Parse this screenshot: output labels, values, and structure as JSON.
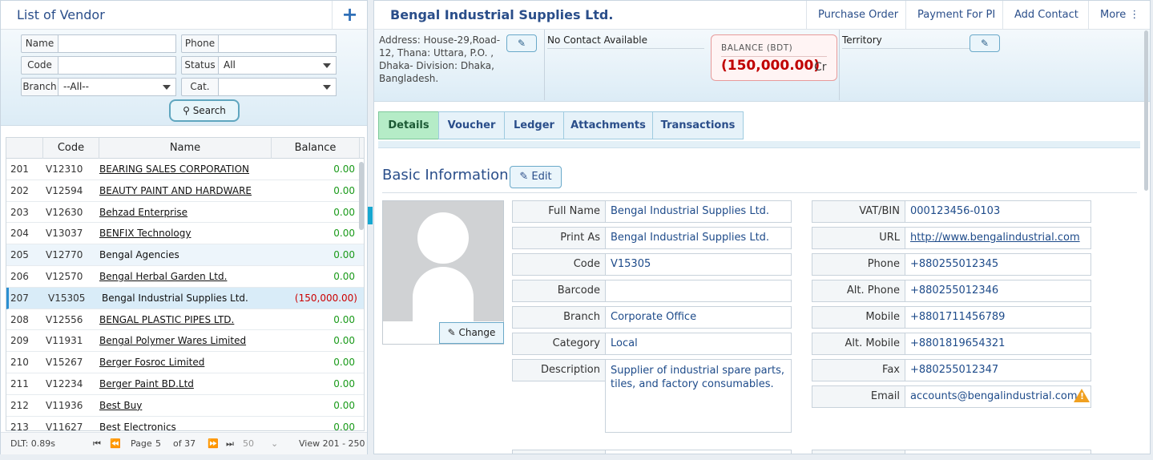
{
  "left": {
    "title": "List of Vendor",
    "add_icon": "plus-icon",
    "filters": {
      "name_label": "Name",
      "name_value": "",
      "phone_label": "Phone",
      "phone_value": "",
      "code_label": "Code",
      "code_value": "",
      "status_label": "Status",
      "status_value": "All",
      "branch_label": "Branch",
      "branch_value": "--All--",
      "cat_label": "Cat.",
      "cat_value": "",
      "search_label": "Search"
    },
    "grid": {
      "columns": [
        "",
        "Code",
        "Name",
        "Balance"
      ],
      "rows": [
        {
          "no": "201",
          "code": "V12310",
          "name": "BEARING SALES CORPORATION",
          "balance": "0.00"
        },
        {
          "no": "202",
          "code": "V12594",
          "name": "BEAUTY PAINT AND HARDWARE",
          "balance": "0.00"
        },
        {
          "no": "203",
          "code": "V12630",
          "name": "Behzad Enterprise",
          "balance": "0.00"
        },
        {
          "no": "204",
          "code": "V13037",
          "name": "BENFIX Technology",
          "balance": "0.00"
        },
        {
          "no": "205",
          "code": "V12770",
          "name": "Bengal Agencies",
          "balance": "0.00"
        },
        {
          "no": "206",
          "code": "V12570",
          "name": "Bengal Herbal Garden Ltd.",
          "balance": "0.00"
        },
        {
          "no": "207",
          "code": "V15305",
          "name": "Bengal Industrial Supplies Ltd.",
          "balance": "(150,000.00)"
        },
        {
          "no": "208",
          "code": "V12556",
          "name": "BENGAL PLASTIC PIPES LTD.",
          "balance": "0.00"
        },
        {
          "no": "209",
          "code": "V11931",
          "name": "Bengal Polymer Wares Limited",
          "balance": "0.00"
        },
        {
          "no": "210",
          "code": "V15267",
          "name": "Berger Fosroc Limited",
          "balance": "0.00"
        },
        {
          "no": "211",
          "code": "V12234",
          "name": "Berger Paint BD.Ltd",
          "balance": "0.00"
        },
        {
          "no": "212",
          "code": "V11936",
          "name": "Best Buy",
          "balance": "0.00"
        },
        {
          "no": "213",
          "code": "V11627",
          "name": "Best Electronics",
          "balance": "0.00"
        }
      ]
    },
    "pager": {
      "dlt": "DLT: 0.89s",
      "page_label": "Page",
      "page": "5",
      "of": "of 37",
      "page_size": "50",
      "view": "View 201 - 250"
    }
  },
  "right": {
    "title": "Bengal Industrial Supplies Ltd.",
    "actions": [
      "Purchase Order",
      "Payment For PI",
      "Add Contact",
      "More ⋮"
    ],
    "address": "Address: House-29,Road-12, Thana: Uttara, P.O. , Dhaka- Division: Dhaka, Bangladesh.",
    "contact": "No Contact Available",
    "balance_label": "BALANCE (BDT)",
    "balance_value": "(150,000.00)",
    "balance_suffix": "Cr",
    "territory": "Territory",
    "tabs": [
      "Details",
      "Voucher",
      "Ledger",
      "Attachments",
      "Transactions"
    ],
    "section_title": "Basic Information",
    "edit_label": "Edit",
    "change_label": "Change",
    "fields_left": [
      {
        "label": "Full Name",
        "value": "Bengal Industrial Supplies Ltd."
      },
      {
        "label": "Print As",
        "value": "Bengal Industrial Supplies Ltd."
      },
      {
        "label": "Code",
        "value": "V15305"
      },
      {
        "label": "Barcode",
        "value": ""
      },
      {
        "label": "Branch",
        "value": "Corporate Office"
      },
      {
        "label": "Category",
        "value": "Local"
      },
      {
        "label": "Description",
        "value": "Supplier of industrial spare parts, tiles, and factory consumables."
      }
    ],
    "fields_right": [
      {
        "label": "VAT/BIN",
        "value": "000123456-0103"
      },
      {
        "label": "URL",
        "value": "http://www.bengalindustrial.com"
      },
      {
        "label": "Phone",
        "value": "+880255012345"
      },
      {
        "label": "Alt. Phone",
        "value": "+880255012346"
      },
      {
        "label": "Mobile",
        "value": "+8801711456789"
      },
      {
        "label": "Alt. Mobile",
        "value": "+8801819654321"
      },
      {
        "label": "Fax",
        "value": "+880255012347"
      },
      {
        "label": "Email",
        "value": "accounts@bengalindustrial.com"
      }
    ]
  },
  "colors": {
    "accent": "#2a4e8a",
    "positive": "#1a9a1a",
    "negative": "#c00000",
    "active_tab": "#b5ecc7"
  }
}
